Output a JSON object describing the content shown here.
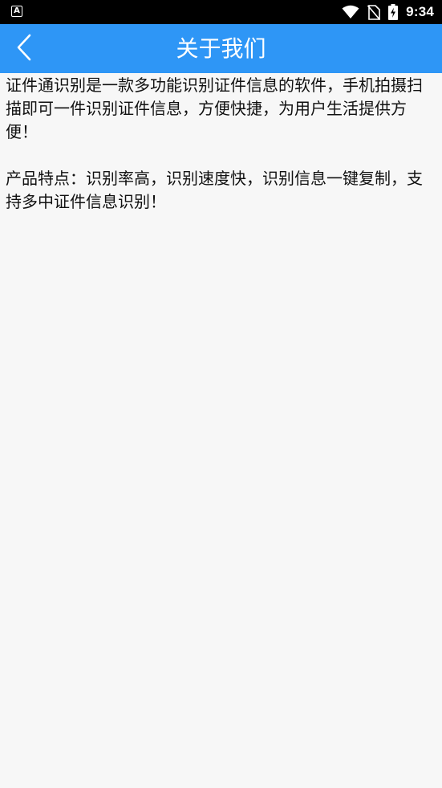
{
  "status_bar": {
    "notification_icon_letter": "A",
    "time": "9:34",
    "icons": [
      "wifi-icon",
      "no-sim-icon",
      "battery-charging-icon"
    ]
  },
  "app_bar": {
    "title": "关于我们",
    "back_icon": "chevron-left-icon",
    "background_color": "#2e96f6"
  },
  "content": {
    "paragraphs": [
      "证件通识别是一款多功能识别证件信息的软件，手机拍摄扫描即可一件识别证件信息，方便快捷，为用户生活提供方便！",
      "产品特点：识别率高，识别速度快，识别信息一键复制，支持多中证件信息识别！"
    ]
  }
}
